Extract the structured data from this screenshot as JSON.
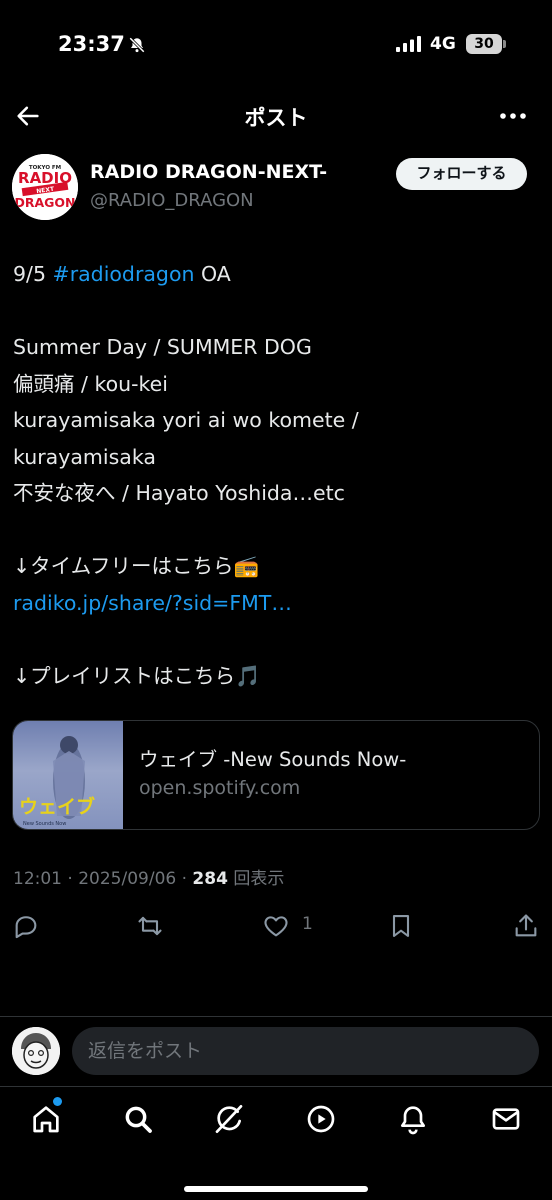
{
  "status_bar": {
    "time": "23:37",
    "network": "4G",
    "battery": "30"
  },
  "header": {
    "title": "ポスト"
  },
  "author": {
    "display_name": "RADIO DRAGON-NEXT-",
    "handle": "@RADIO_DRAGON",
    "avatar_text_top": "TOKYO FM",
    "avatar_text_radio": "RADIO",
    "avatar_text_next": "NEXT",
    "avatar_text_dragon": "DRAGON",
    "follow_label": "フォローする"
  },
  "tweet": {
    "line1_prefix": "9/5 ",
    "line1_hashtag": "#radiodragon",
    "line1_suffix": " OA",
    "songs": [
      "Summer Day  / SUMMER DOG",
      "偏頭痛  / kou-kei",
      "kurayamisaka yori ai wo komete  /",
      "kurayamisaka",
      "不安な夜へ  / Hayato Yoshida…etc"
    ],
    "timefree_label": "↓タイムフリーはこちら📻",
    "timefree_link": "radiko.jp/share/?sid=FMT…",
    "playlist_label": "↓プレイリストはこちら🎵"
  },
  "card": {
    "thumb_text": "ウェイブ",
    "thumb_sub": "New Sounds Now",
    "title": "ウェイブ -New Sounds Now-",
    "domain": "open.spotify.com"
  },
  "meta": {
    "time": "12:01",
    "date": "2025/09/06",
    "views_count": "284",
    "views_label": "回表示"
  },
  "actions": {
    "like_count": "1"
  },
  "reply": {
    "placeholder": "返信をポスト"
  },
  "colors": {
    "accent": "#1d9bf0",
    "background": "#000000",
    "muted": "#71767b",
    "divider": "#2f3336"
  },
  "icons": {
    "nav": [
      "home-icon",
      "search-icon",
      "grok-icon",
      "video-icon",
      "notifications-icon",
      "messages-icon"
    ],
    "actions": [
      "reply-icon",
      "repost-icon",
      "like-icon",
      "bookmark-icon",
      "share-icon"
    ]
  }
}
